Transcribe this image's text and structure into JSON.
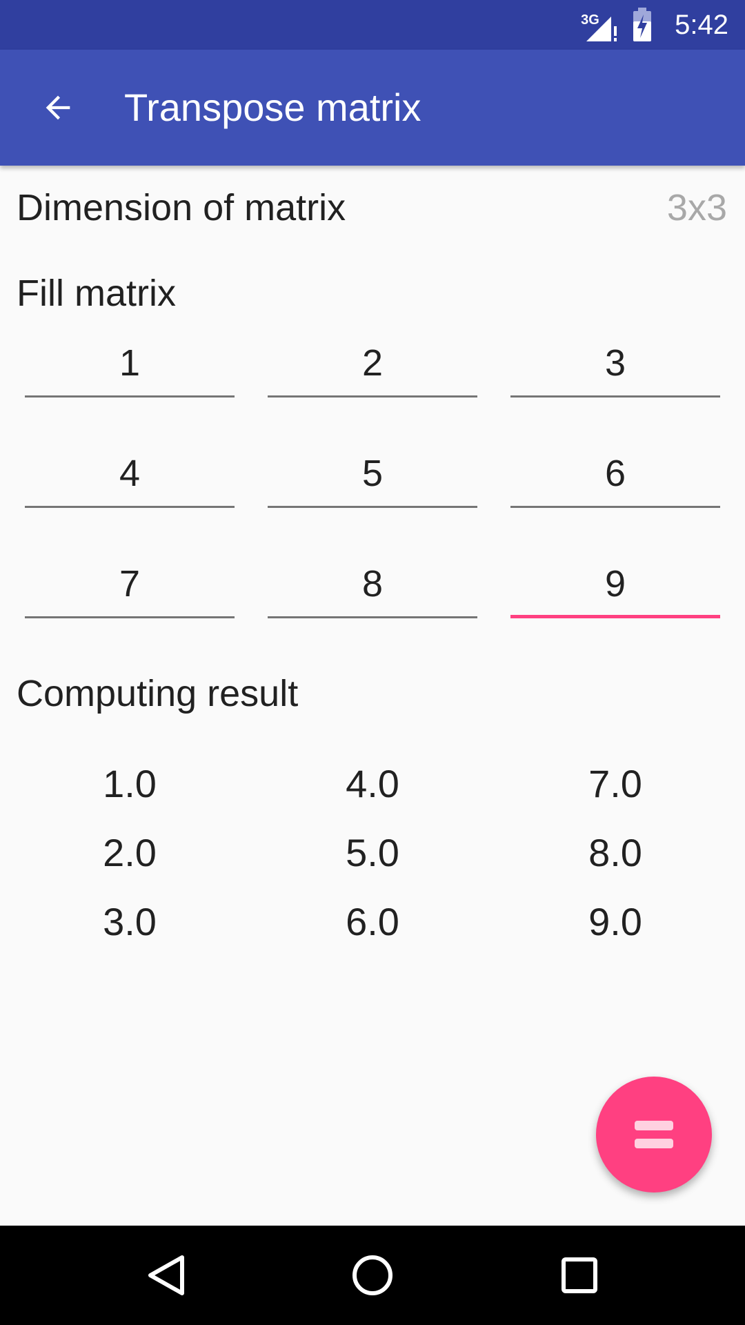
{
  "status_bar": {
    "network": "3G",
    "time": "5:42"
  },
  "app_bar": {
    "back_icon": "arrow-back-icon",
    "title": "Transpose matrix"
  },
  "dimension": {
    "label": "Dimension of matrix",
    "value": "3x3"
  },
  "fill": {
    "title": "Fill matrix",
    "rows": [
      [
        "1",
        "2",
        "3"
      ],
      [
        "4",
        "5",
        "6"
      ],
      [
        "7",
        "8",
        "9"
      ]
    ]
  },
  "result": {
    "title": "Computing result",
    "rows": [
      [
        "1.0",
        "4.0",
        "7.0"
      ],
      [
        "2.0",
        "5.0",
        "8.0"
      ],
      [
        "3.0",
        "6.0",
        "9.0"
      ]
    ]
  },
  "fab": {
    "icon": "equals-icon"
  },
  "nav": {
    "back_icon": "nav-back-icon",
    "home_icon": "nav-home-icon",
    "recents_icon": "nav-recents-icon"
  },
  "colors": {
    "primary": "#3f51b5",
    "primary_dark": "#303f9f",
    "accent": "#ff4081"
  }
}
